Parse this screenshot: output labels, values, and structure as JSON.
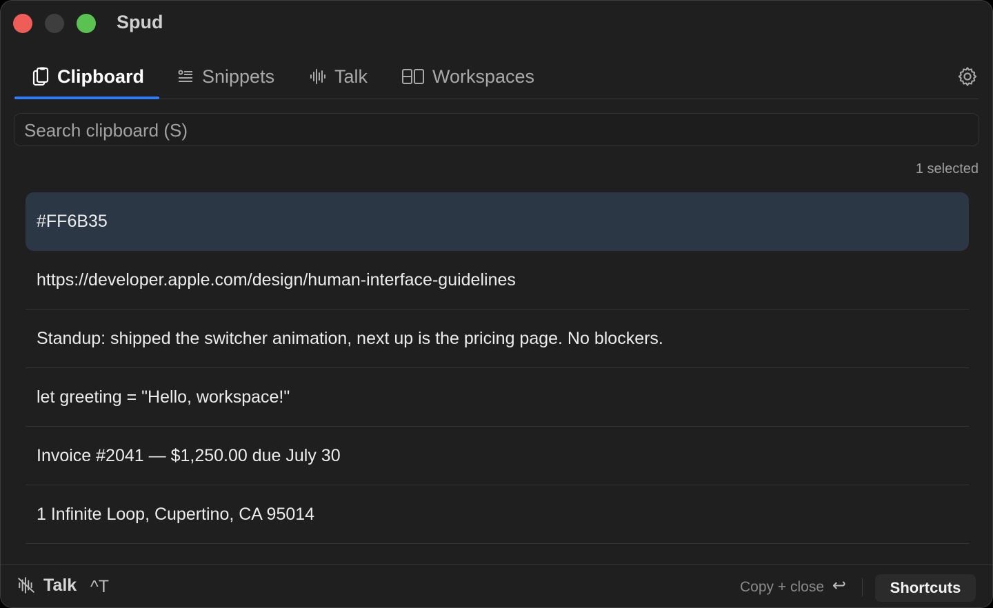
{
  "app": {
    "title": "Spud"
  },
  "tabs": [
    {
      "label": "Clipboard",
      "icon": "clipboard-icon",
      "active": true
    },
    {
      "label": "Snippets",
      "icon": "snippets-icon",
      "active": false
    },
    {
      "label": "Talk",
      "icon": "waveform-icon",
      "active": false
    },
    {
      "label": "Workspaces",
      "icon": "workspaces-icon",
      "active": false
    }
  ],
  "search": {
    "placeholder": "Search clipboard (S)",
    "value": ""
  },
  "selection": {
    "count_label": "1 selected"
  },
  "clipboard_items": [
    {
      "text": "#FF6B35",
      "selected": true
    },
    {
      "text": "https://developer.apple.com/design/human-interface-guidelines",
      "selected": false
    },
    {
      "text": "Standup: shipped the switcher animation, next up is the pricing page. No blockers.",
      "selected": false
    },
    {
      "text": "let greeting = \"Hello, workspace!\"",
      "selected": false
    },
    {
      "text": "Invoice #2041 — $1,250.00 due July 30",
      "selected": false
    },
    {
      "text": "1 Infinite Loop, Cupertino, CA 95014",
      "selected": false
    }
  ],
  "footer": {
    "talk_label": "Talk",
    "talk_shortcut": "^T",
    "copy_hint": "Copy + close",
    "return_glyph": "↩",
    "shortcuts_label": "Shortcuts"
  },
  "colors": {
    "accent": "#2f7df6",
    "selected_row": "#2c3746",
    "close": "#ee5d57",
    "zoom": "#5ac251"
  }
}
